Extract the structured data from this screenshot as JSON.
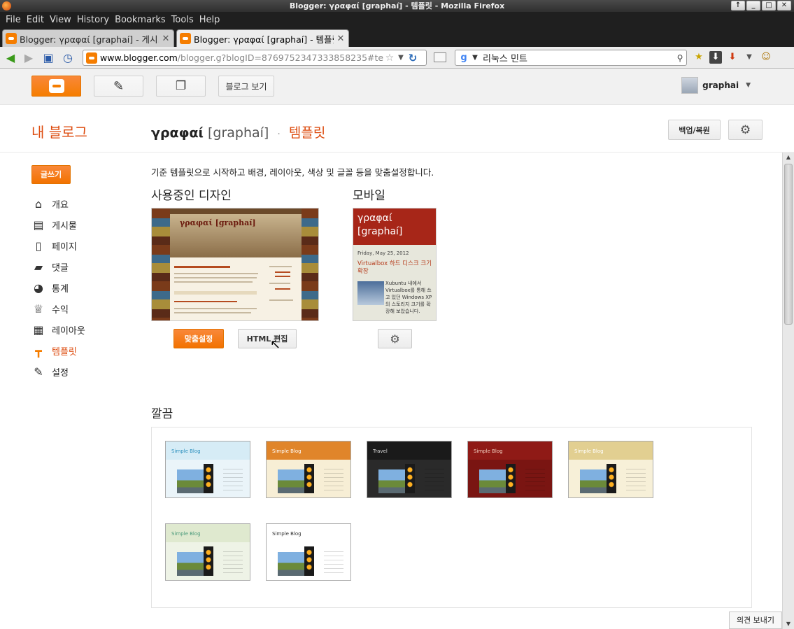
{
  "window": {
    "title": "Blogger: γραφαί [graphaí] - 템플릿 - Mozilla Firefox",
    "controls": [
      "↑",
      "_",
      "□",
      "✕"
    ]
  },
  "menu": [
    "File",
    "Edit",
    "View",
    "History",
    "Bookmarks",
    "Tools",
    "Help"
  ],
  "tabs": [
    {
      "label": "Blogger: γραφαί [graphaí] - 게시…",
      "active": false
    },
    {
      "label": "Blogger: γραφαί [graphaí] - 템플릿",
      "active": true
    }
  ],
  "navbar": {
    "url_domain": "www.blogger.com",
    "url_rest": "/blogger.g?blogID=8769752347333858235#temp",
    "search_query": "리눅스 민트",
    "search_engine_icon": "google-icon"
  },
  "toolbar": {
    "view_blog_label": "블로그 보기",
    "username": "graphai"
  },
  "header": {
    "my_blogs": "내 블로그",
    "blog_name": "γραφαί",
    "blog_sub": "[graphaí]",
    "separator": "·",
    "page_name": "템플릿",
    "backup_label": "백업/복원"
  },
  "sidebar": {
    "new_post": "글쓰기",
    "items": [
      {
        "label": "개요",
        "icon": "home-icon",
        "glyph": "⌂",
        "active": false
      },
      {
        "label": "게시물",
        "icon": "posts-icon",
        "glyph": "▤",
        "active": false
      },
      {
        "label": "페이지",
        "icon": "page-icon",
        "glyph": "▯",
        "active": false
      },
      {
        "label": "댓글",
        "icon": "comment-icon",
        "glyph": "▰",
        "active": false
      },
      {
        "label": "통계",
        "icon": "stats-pie-icon",
        "glyph": "◕",
        "active": false
      },
      {
        "label": "수익",
        "icon": "trophy-icon",
        "glyph": "♕",
        "active": false
      },
      {
        "label": "레이아웃",
        "icon": "layout-icon",
        "glyph": "▦",
        "active": false
      },
      {
        "label": "템플릿",
        "icon": "template-icon",
        "glyph": "┳",
        "active": true
      },
      {
        "label": "설정",
        "icon": "wrench-icon",
        "glyph": "✎",
        "active": false
      }
    ]
  },
  "main": {
    "intro": "기준 템플릿으로 시작하고 배경, 레이아웃, 색상 및 글꼴 등을 맞춤설정합니다.",
    "current_design_heading": "사용중인 디자인",
    "mobile_heading": "모바일",
    "desktop_preview_title": "γραφαί [graphaí]",
    "mobile_preview": {
      "title": "γραφαί [graphaí]",
      "date": "Friday, May 25, 2012",
      "post_title": "Virtualbox 하드 디스크 크기 확장",
      "post_text": "Xubuntu 내에서 Virtualbox를 통해 쓰고 있던 Windows XP의 스토리지 크기를 확장해 보았습니다."
    },
    "customize_label": "맞춤설정",
    "edit_html_label": "HTML 편집",
    "gallery_heading": "깔끔",
    "templates": [
      {
        "name": "Simple Blog",
        "variant": "light-blue",
        "bg": "#eaf4f9",
        "head": "#d6ecf6",
        "title_color": "#2a8fbd"
      },
      {
        "name": "Simple Blog",
        "variant": "orange",
        "bg": "#f7eed5",
        "head": "#e0852a",
        "title_color": "#ffffff"
      },
      {
        "name": "Travel",
        "variant": "dark",
        "bg": "#2a2a2a",
        "head": "#1a1a1a",
        "title_color": "#dddddd"
      },
      {
        "name": "Simple Blog",
        "variant": "red",
        "bg": "#7a1512",
        "head": "#8f1a16",
        "title_color": "#f2d0c0"
      },
      {
        "name": "Simple Blog",
        "variant": "tan",
        "bg": "#f7f0d8",
        "head": "#e2cf91",
        "title_color": "#ffffff"
      },
      {
        "name": "Simple Blog",
        "variant": "sage",
        "bg": "#eef3e6",
        "head": "#dfe9cf",
        "title_color": "#4a9a7a"
      },
      {
        "name": "Simple Blog",
        "variant": "white",
        "bg": "#ffffff",
        "head": "#ffffff",
        "title_color": "#333333"
      }
    ],
    "feedback_label": "의견 보내기"
  },
  "colors": {
    "accent": "#f57d00",
    "accent_text": "#dd4b0e"
  }
}
